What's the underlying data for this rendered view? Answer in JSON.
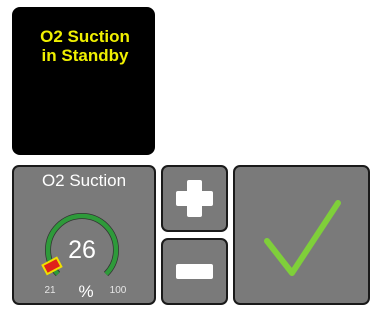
{
  "status": {
    "line1": "O2 Suction",
    "line2": "in Standby"
  },
  "gauge": {
    "title": "O2 Suction",
    "value": "26",
    "unit": "%",
    "min_label": "21",
    "max_label": "100",
    "min": 21,
    "max": 100,
    "current": 26
  },
  "colors": {
    "status_text": "#f0f000",
    "tile_bg": "#7a7a7a",
    "gauge_arc": "#2e9a3a",
    "gauge_marker": "#e0221b",
    "gauge_marker_edge": "#f0e000",
    "confirm_check": "#7fcf3a"
  },
  "icons": {
    "increase": "plus-icon",
    "decrease": "minus-icon",
    "confirm": "checkmark-icon"
  }
}
